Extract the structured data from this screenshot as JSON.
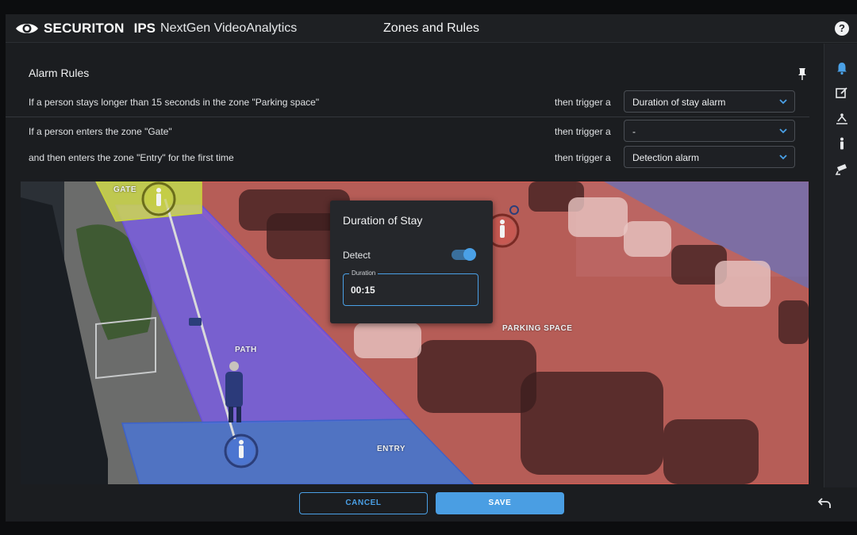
{
  "header": {
    "brand_name": "SECURITON",
    "brand_ips": "IPS",
    "brand_product": "NextGen VideoAnalytics",
    "title": "Zones and Rules",
    "help_glyph": "?"
  },
  "sidebar": {
    "icons": [
      "bell-icon",
      "edit-icon",
      "zones-icon",
      "person-icon",
      "camera-icon"
    ],
    "active_color": "#4aa0e6"
  },
  "rules": {
    "title": "Alarm Rules",
    "trigger_text": "then trigger a",
    "items": [
      {
        "text": "If a person stays longer than 15 seconds in the zone \"Parking space\"",
        "alarm": "Duration of stay alarm"
      },
      {
        "text": "If a person enters the zone \"Gate\"",
        "alarm": "-"
      },
      {
        "text": "and then enters the zone \"Entry\" for the first time",
        "alarm": "Detection alarm"
      }
    ]
  },
  "video": {
    "zones": [
      "GATE",
      "PATH",
      "PARKING SPACE",
      "ENTRY"
    ],
    "colors": {
      "gate": "#d4e04a",
      "path": "#7a5ee0",
      "parking": "#d2574f",
      "entry": "#4a76d8"
    }
  },
  "dialog": {
    "title": "Duration of Stay",
    "detect_label": "Detect",
    "detect_on": true,
    "duration_label": "Duration",
    "duration_value": "00:15"
  },
  "footer": {
    "cancel_label": "CANCEL",
    "save_label": "SAVE"
  },
  "colors": {
    "accent": "#4aa0e6",
    "background": "#1b1d20"
  }
}
